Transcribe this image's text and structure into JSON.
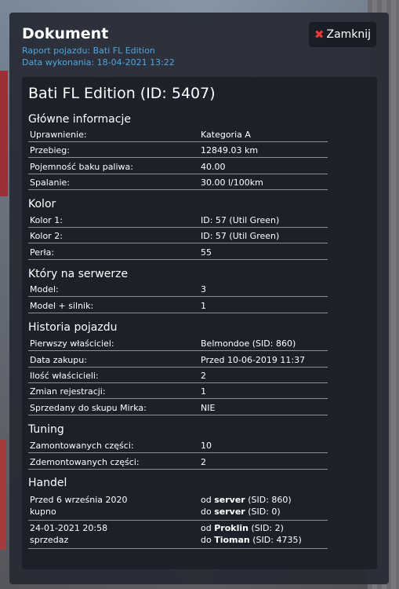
{
  "header": {
    "title": "Dokument",
    "subtitle_report": "Raport pojazdu: Bati FL Edition",
    "subtitle_date": "Data wykonania: 18-04-2021 13:22",
    "close_label": "Zamknij"
  },
  "vehicle": {
    "title": "Bati FL Edition (ID: 5407)"
  },
  "sections": {
    "main": {
      "title": "Główne informacje",
      "rows": [
        {
          "k": "Uprawnienie:",
          "v": "Kategoria A"
        },
        {
          "k": "Przebieg:",
          "v": "12849.03 km"
        },
        {
          "k": "Pojemność baku paliwa:",
          "v": "40.00"
        },
        {
          "k": "Spalanie:",
          "v": "30.00 l/100km"
        }
      ]
    },
    "color": {
      "title": "Kolor",
      "rows": [
        {
          "k": "Kolor 1:",
          "v": "ID: 57 (Util Green)"
        },
        {
          "k": "Kolor 2:",
          "v": "ID: 57 (Util Green)"
        },
        {
          "k": "Perła:",
          "v": "55"
        }
      ]
    },
    "server": {
      "title": "Który na serwerze",
      "rows": [
        {
          "k": "Model:",
          "v": "3"
        },
        {
          "k": "Model + silnik:",
          "v": "1"
        }
      ]
    },
    "history": {
      "title": "Historia pojazdu",
      "rows": [
        {
          "k": "Pierwszy właściciel:",
          "v": "Belmondoe (SID: 860)"
        },
        {
          "k": "Data zakupu:",
          "v": "Przed 10-06-2019 11:37"
        },
        {
          "k": "Ilość właścicieli:",
          "v": "2"
        },
        {
          "k": "Zmian rejestracji:",
          "v": "1"
        },
        {
          "k": "Sprzedany do skupu Mirka:",
          "v": "NIE"
        }
      ]
    },
    "tuning": {
      "title": "Tuning",
      "rows": [
        {
          "k": "Zamontowanych części:",
          "v": "10"
        },
        {
          "k": "Zdemontowanych części:",
          "v": "2"
        }
      ]
    },
    "trade": {
      "title": "Handel",
      "entries": [
        {
          "date": "Przed 6 września 2020",
          "type": "kupno",
          "from_prefix": "od",
          "from_name": "server",
          "from_sid": "(SID: 860)",
          "to_prefix": "do",
          "to_name": "server",
          "to_sid": "(SID: 0)"
        },
        {
          "date": "24-01-2021 20:58",
          "type": "sprzedaz",
          "from_prefix": "od",
          "from_name": "Proklin",
          "from_sid": "(SID: 2)",
          "to_prefix": "do",
          "to_name": "Tioman",
          "to_sid": "(SID: 4735)"
        }
      ]
    }
  },
  "colors": {
    "accent_blue": "#4fa7de",
    "close_icon": "#e23b3b",
    "panel_bg": "#1c1f28"
  },
  "icons": {
    "close": "close-icon"
  }
}
